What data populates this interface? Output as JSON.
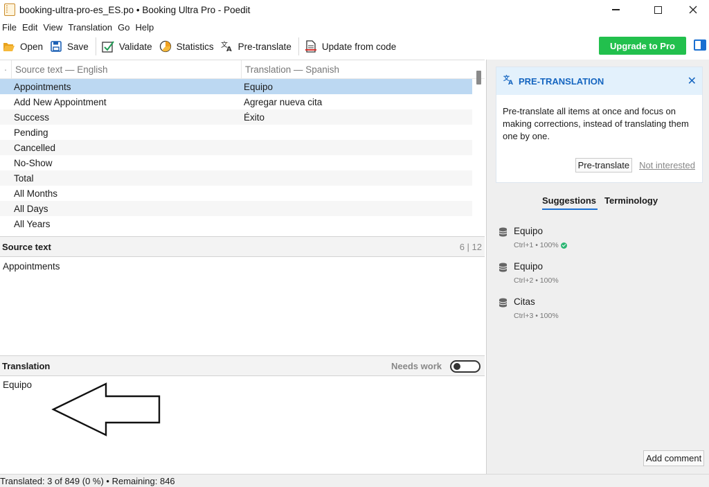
{
  "window": {
    "title": "booking-ultra-pro-es_ES.po • Booking Ultra Pro - Poedit"
  },
  "menu": [
    "File",
    "Edit",
    "View",
    "Translation",
    "Go",
    "Help"
  ],
  "toolbar": {
    "open": "Open",
    "save": "Save",
    "validate": "Validate",
    "statistics": "Statistics",
    "pretranslate": "Pre-translate",
    "update": "Update from code",
    "upgrade": "Upgrade to Pro"
  },
  "list": {
    "dot": "·",
    "col_source": "Source text — English",
    "col_translation": "Translation — Spanish",
    "rows": [
      {
        "source": "Appointments",
        "translation": "Equipo"
      },
      {
        "source": "Add New Appointment",
        "translation": "Agregar nueva cita"
      },
      {
        "source": "Success",
        "translation": "Éxito"
      },
      {
        "source": "Pending",
        "translation": ""
      },
      {
        "source": "Cancelled",
        "translation": ""
      },
      {
        "source": "No-Show",
        "translation": ""
      },
      {
        "source": "Total",
        "translation": ""
      },
      {
        "source": "All Months",
        "translation": ""
      },
      {
        "source": "All Days",
        "translation": ""
      },
      {
        "source": "All Years",
        "translation": ""
      }
    ]
  },
  "source_panel": {
    "header": "Source text",
    "counter": "6 | 12",
    "text": "Appointments"
  },
  "translation_panel": {
    "header": "Translation",
    "needs_work": "Needs work",
    "text": "Equipo"
  },
  "status": {
    "text": "Translated: 3 of 849 (0 %)  •  Remaining: 846"
  },
  "sidebar": {
    "pretranslation": {
      "title": "PRE-TRANSLATION",
      "body": "Pre-translate all items at once and focus on making corrections, instead of translating them one by one.",
      "button": "Pre-translate",
      "link": "Not interested"
    },
    "tabs": [
      "Suggestions",
      "Terminology"
    ],
    "suggestions": [
      {
        "text": "Equipo",
        "meta": "Ctrl+1 • 100%"
      },
      {
        "text": "Equipo",
        "meta": "Ctrl+2 • 100%"
      },
      {
        "text": "Citas",
        "meta": "Ctrl+3 • 100%"
      }
    ],
    "add_comment": "Add comment"
  },
  "colors": {
    "accent": "#1a6fd1",
    "upgrade": "#22c04d",
    "selection": "#bcd8f2"
  }
}
